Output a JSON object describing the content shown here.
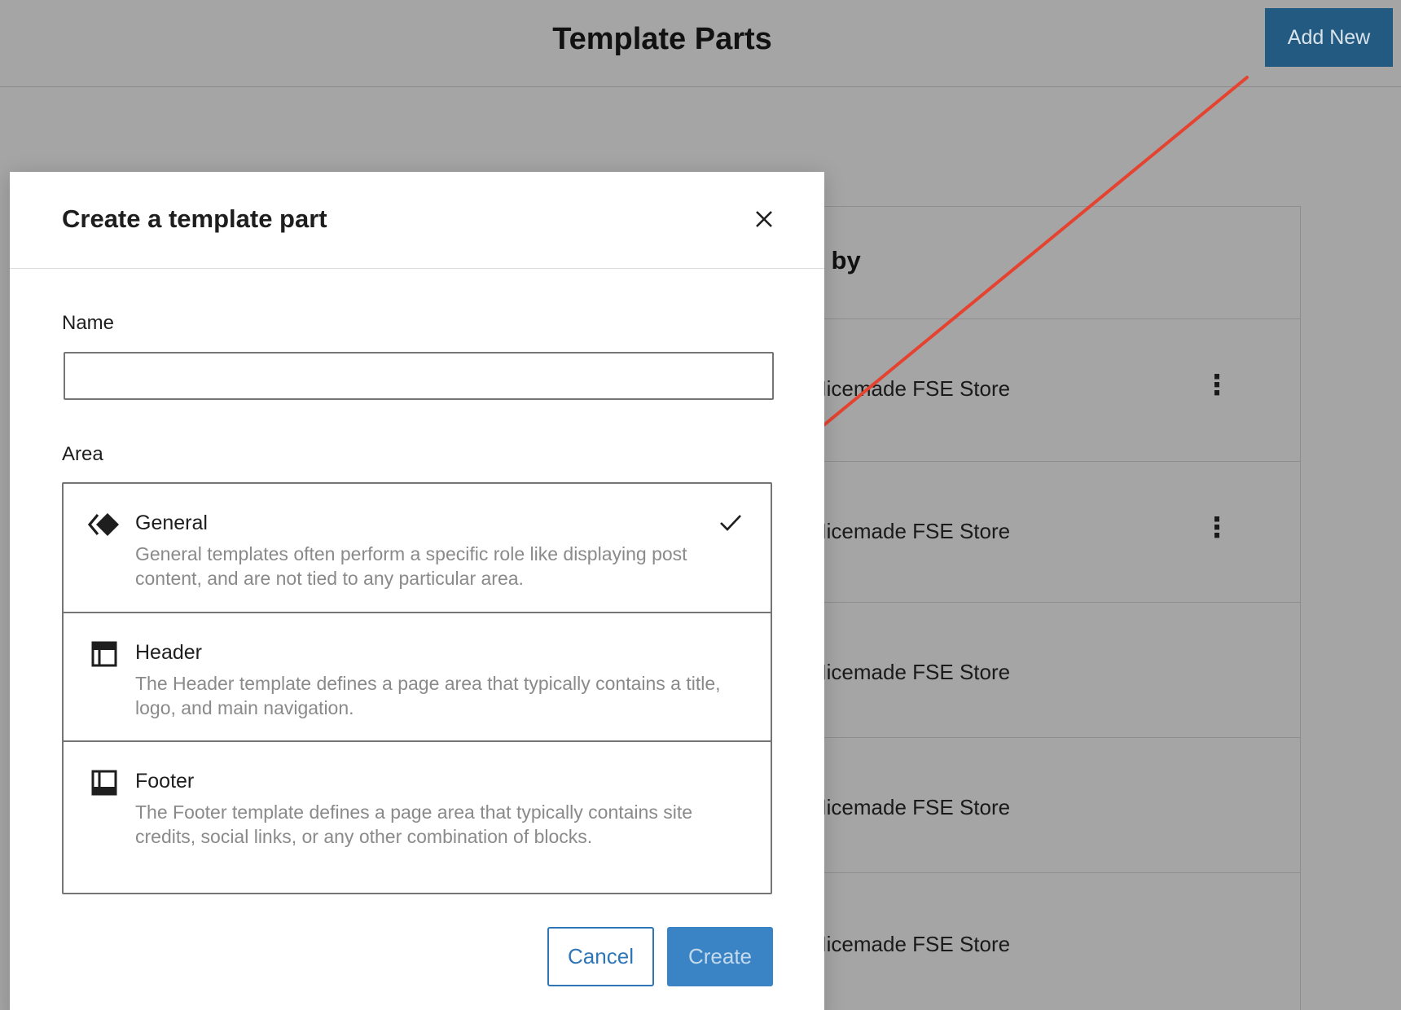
{
  "page": {
    "title": "Template Parts",
    "add_new_label": "Add New"
  },
  "table": {
    "column_header": "d by",
    "rows": [
      {
        "author": "Micemade FSE Store",
        "has_actions": true
      },
      {
        "author": "Micemade FSE Store",
        "has_actions": true
      },
      {
        "author": "Micemade FSE Store",
        "has_actions": false
      },
      {
        "author": "Micemade FSE Store",
        "has_actions": false
      },
      {
        "author": "Micemade FSE Store",
        "has_actions": false
      }
    ],
    "actions_glyph": "⋮"
  },
  "modal": {
    "title": "Create a template part",
    "name_label": "Name",
    "name_value": "",
    "area_label": "Area",
    "areas": [
      {
        "name": "General",
        "icon": "symbol-icon",
        "selected": true,
        "description": "General templates often perform a specific role like displaying post content, and are not tied to any particular area."
      },
      {
        "name": "Header",
        "icon": "header-icon",
        "selected": false,
        "description": "The Header template defines a page area that typically contains a title, logo, and main navigation."
      },
      {
        "name": "Footer",
        "icon": "footer-icon",
        "selected": false,
        "description": "The Footer template defines a page area that typically contains site credits, social links, or any other combination of blocks."
      }
    ],
    "cancel_label": "Cancel",
    "create_label": "Create"
  },
  "colors": {
    "overlay": "#a5a5a5",
    "primary": "#3a84c5",
    "add_new_bg": "#235a82",
    "annotation_arrow": "#e5432f"
  }
}
